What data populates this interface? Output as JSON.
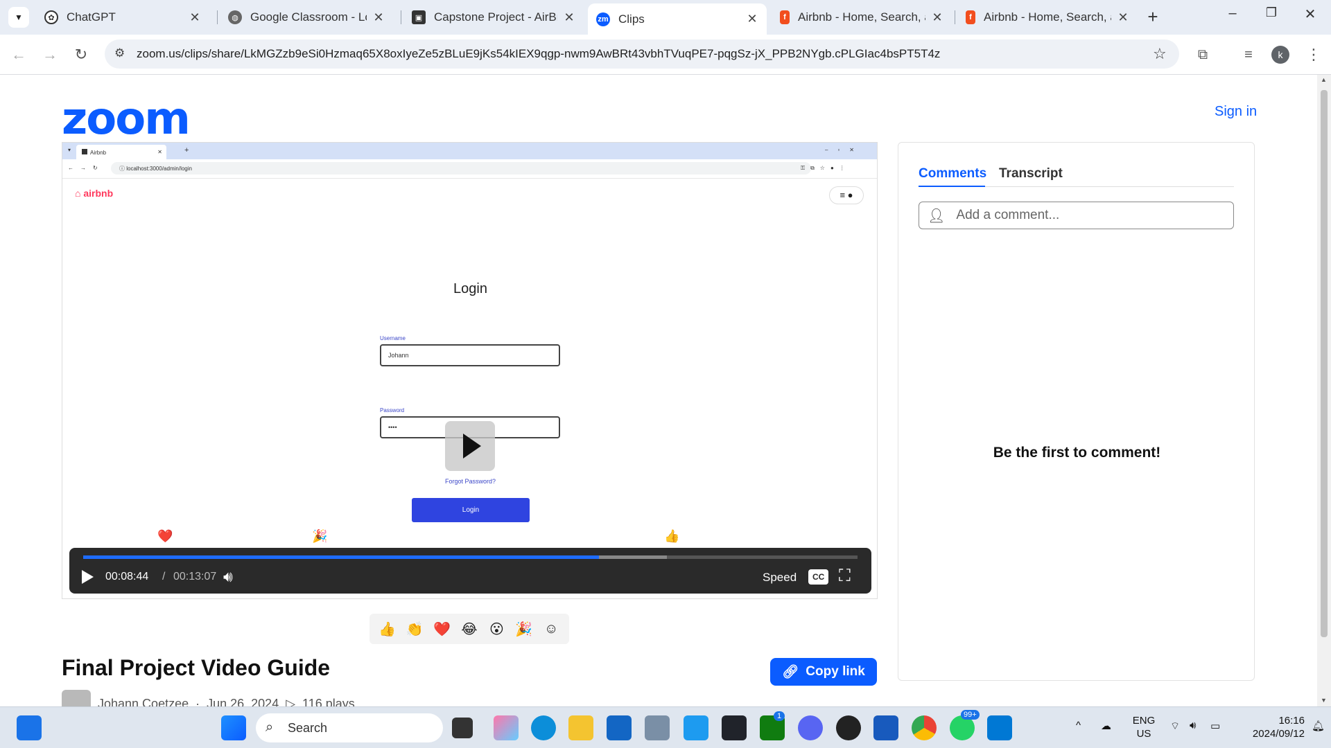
{
  "browser": {
    "tabs": [
      {
        "title": "ChatGPT",
        "icon": "openai-icon",
        "active": false
      },
      {
        "title": "Google Classroom - Login",
        "icon": "globe-icon",
        "active": false
      },
      {
        "title": "Capstone Project - AirBnb",
        "icon": "classroom-icon",
        "active": false
      },
      {
        "title": "Clips",
        "icon": "zoom-icon",
        "active": true
      },
      {
        "title": "Airbnb - Home, Search, an",
        "icon": "figma-icon",
        "active": false
      },
      {
        "title": "Airbnb - Home, Search, an",
        "icon": "figma-icon",
        "active": false
      }
    ],
    "url": "zoom.us/clips/share/LkMGZzb9eSi0Hzmaq65X8oxIyeZe5zBLuE9jKs54kIEX9qgp-nwm9AwBRt43vbhTVuqPE7-pqgSz-jX_PPB2NYgb.cPLGIac4bsPT5T4z",
    "profile_initial": "k"
  },
  "header": {
    "logo_text": "zoom",
    "signin_label": "Sign in"
  },
  "video": {
    "inner": {
      "tab_title": "Airbnb",
      "url": "localhost:3000/admin/login",
      "brand": "airbnb",
      "login_title": "Login",
      "username_label": "Username",
      "username_value": "Johann",
      "password_label": "Password",
      "password_value": "••••",
      "forgot_label": "Forgot Password?",
      "login_button": "Login"
    },
    "current_time": "00:08:44",
    "separator": "/",
    "duration": "00:13:07",
    "progress_fraction": 0.666,
    "buffered_fraction": 0.754,
    "speed_label": "Speed",
    "cc_label": "CC",
    "timeline_reactions": [
      "❤️",
      "🎉",
      "👍"
    ]
  },
  "reactions": [
    "👍",
    "👏",
    "❤️",
    "😂",
    "😮",
    "🎉",
    "☺"
  ],
  "clip": {
    "title": "Final Project Video Guide",
    "copy_label": "Copy link",
    "author": "Johann Coetzee",
    "date": "Jun 26, 2024",
    "plays": "116 plays"
  },
  "comments": {
    "tab_comments": "Comments",
    "tab_transcript": "Transcript",
    "placeholder": "Add a comment...",
    "empty_text": "Be the first to comment!"
  },
  "taskbar": {
    "search_label": "Search",
    "lang": "ENG",
    "region": "US",
    "time": "16:16",
    "date": "2024/09/12",
    "badge_xbox": "1",
    "badge_whatsapp": "99+"
  },
  "colors": {
    "zoom_blue": "#0b5cff",
    "airbnb_red": "#ff385c",
    "inner_button": "#2f44e0"
  }
}
